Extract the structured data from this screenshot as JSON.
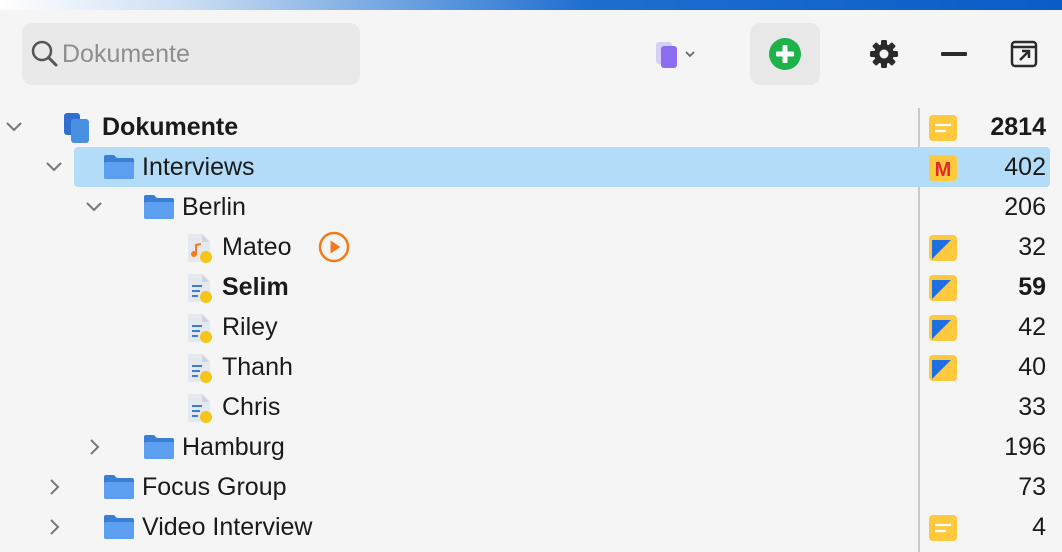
{
  "search": {
    "placeholder": "Dokumente",
    "value": ""
  },
  "toolbar": {
    "filter_icon": "document-filter-icon",
    "add_icon": "add-circle-icon",
    "settings_icon": "gear-icon",
    "minimize_icon": "minus-icon",
    "popout_icon": "popout-icon"
  },
  "colors": {
    "selection": "#b3dcf8",
    "folder": "#4a90e2",
    "add_green": "#1fb14a",
    "memo_yellow": "#ffc83d",
    "play_orange": "#f07c1a"
  },
  "tree": [
    {
      "label": "Dokumente",
      "count": "2814",
      "bold": true,
      "icon": "documents-root-icon",
      "badge": "memo-icon",
      "expanded": true
    },
    {
      "label": "Interviews",
      "count": "402",
      "icon": "folder-icon",
      "badge": "memo-m-icon",
      "expanded": true,
      "selected": true
    },
    {
      "label": "Berlin",
      "count": "206",
      "icon": "folder-icon",
      "expanded": true
    },
    {
      "label": "Mateo",
      "count": "32",
      "icon": "audio-document-icon",
      "badge": "memo-coded-icon",
      "extra": "play-icon"
    },
    {
      "label": "Selim",
      "count": "59",
      "bold": true,
      "icon": "text-document-icon",
      "badge": "memo-coded-icon"
    },
    {
      "label": "Riley",
      "count": "42",
      "icon": "text-document-icon",
      "badge": "memo-coded-icon"
    },
    {
      "label": "Thanh",
      "count": "40",
      "icon": "text-document-icon",
      "badge": "memo-coded-icon"
    },
    {
      "label": "Chris",
      "count": "33",
      "icon": "text-document-icon"
    },
    {
      "label": "Hamburg",
      "count": "196",
      "icon": "folder-icon",
      "expanded": false
    },
    {
      "label": "Focus Group",
      "count": "73",
      "icon": "folder-icon",
      "expanded": false
    },
    {
      "label": "Video Interview",
      "count": "4",
      "icon": "folder-icon",
      "badge": "memo-icon",
      "expanded": false
    }
  ]
}
